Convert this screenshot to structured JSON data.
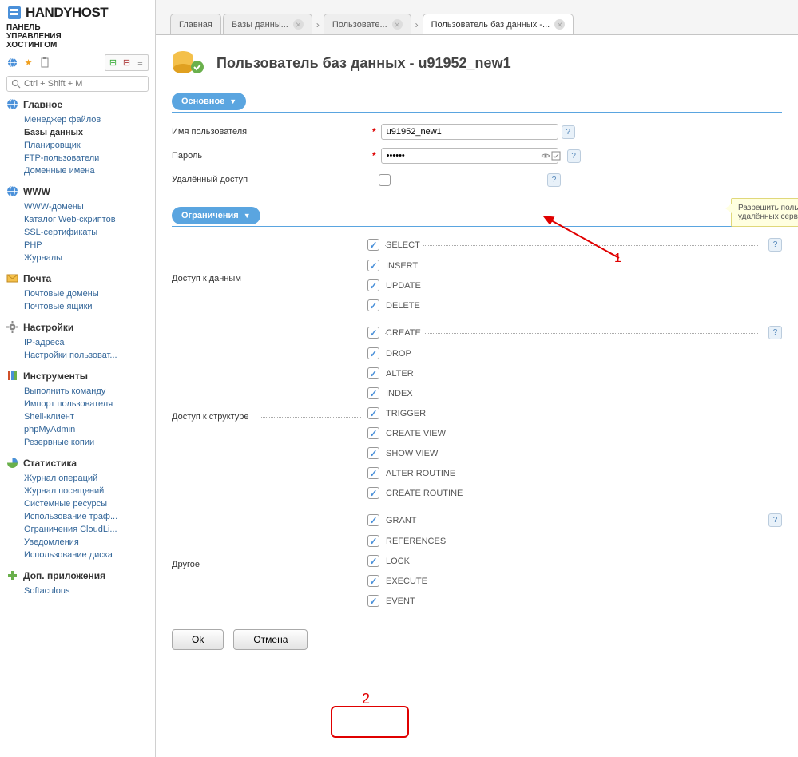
{
  "brand": {
    "name": "HANDYHOST",
    "subtitle": "ПАНЕЛЬ\nУПРАВЛЕНИЯ\nХОСТИНГОМ"
  },
  "search": {
    "placeholder": "Ctrl + Shift + M"
  },
  "nav": [
    {
      "title": "Главное",
      "icon": "globe",
      "items": [
        "Менеджер файлов",
        "Базы данных",
        "Планировщик",
        "FTP-пользователи",
        "Доменные имена"
      ],
      "active": 1
    },
    {
      "title": "WWW",
      "icon": "globe",
      "items": [
        "WWW-домены",
        "Каталог Web-скриптов",
        "SSL-сертификаты",
        "PHP",
        "Журналы"
      ]
    },
    {
      "title": "Почта",
      "icon": "mail",
      "items": [
        "Почтовые домены",
        "Почтовые ящики"
      ]
    },
    {
      "title": "Настройки",
      "icon": "gear",
      "items": [
        "IP-адреса",
        "Настройки пользоват..."
      ]
    },
    {
      "title": "Инструменты",
      "icon": "tools",
      "items": [
        "Выполнить команду",
        "Импорт пользователя",
        "Shell-клиент",
        "phpMyAdmin",
        "Резервные копии"
      ]
    },
    {
      "title": "Статистика",
      "icon": "chart",
      "items": [
        "Журнал операций",
        "Журнал посещений",
        "Системные ресурсы",
        "Использование траф...",
        "Ограничения CloudLi...",
        "Уведомления",
        "Использование диска"
      ]
    },
    {
      "title": "Доп. приложения",
      "icon": "plus",
      "items": [
        "Softaculous"
      ]
    }
  ],
  "tabs": [
    "Главная",
    "Базы данны...",
    "Пользовате...",
    "Пользователь баз данных -..."
  ],
  "tabs_active": 3,
  "page": {
    "title": "Пользователь баз данных - u91952_new1"
  },
  "sections": {
    "main": "Основное",
    "limits": "Ограничения"
  },
  "form": {
    "username_label": "Имя пользователя",
    "username_value": "u91952_new1",
    "password_label": "Пароль",
    "password_value": "••••••",
    "remote_label": "Удалённый доступ"
  },
  "perm": {
    "data_label": "Доступ к данным",
    "struct_label": "Доступ к структуре",
    "other_label": "Другое",
    "data": [
      "SELECT",
      "INSERT",
      "UPDATE",
      "DELETE"
    ],
    "struct": [
      "CREATE",
      "DROP",
      "ALTER",
      "INDEX",
      "TRIGGER",
      "CREATE VIEW",
      "SHOW VIEW",
      "ALTER ROUTINE",
      "CREATE ROUTINE"
    ],
    "other": [
      "GRANT",
      "REFERENCES",
      "LOCK",
      "EXECUTE",
      "EVENT"
    ]
  },
  "buttons": {
    "ok": "Ok",
    "cancel": "Отмена"
  },
  "hint": "Разрешить пользователю баз данных доступ с удалённых серверов",
  "annot": {
    "n1": "1",
    "n2": "2"
  }
}
